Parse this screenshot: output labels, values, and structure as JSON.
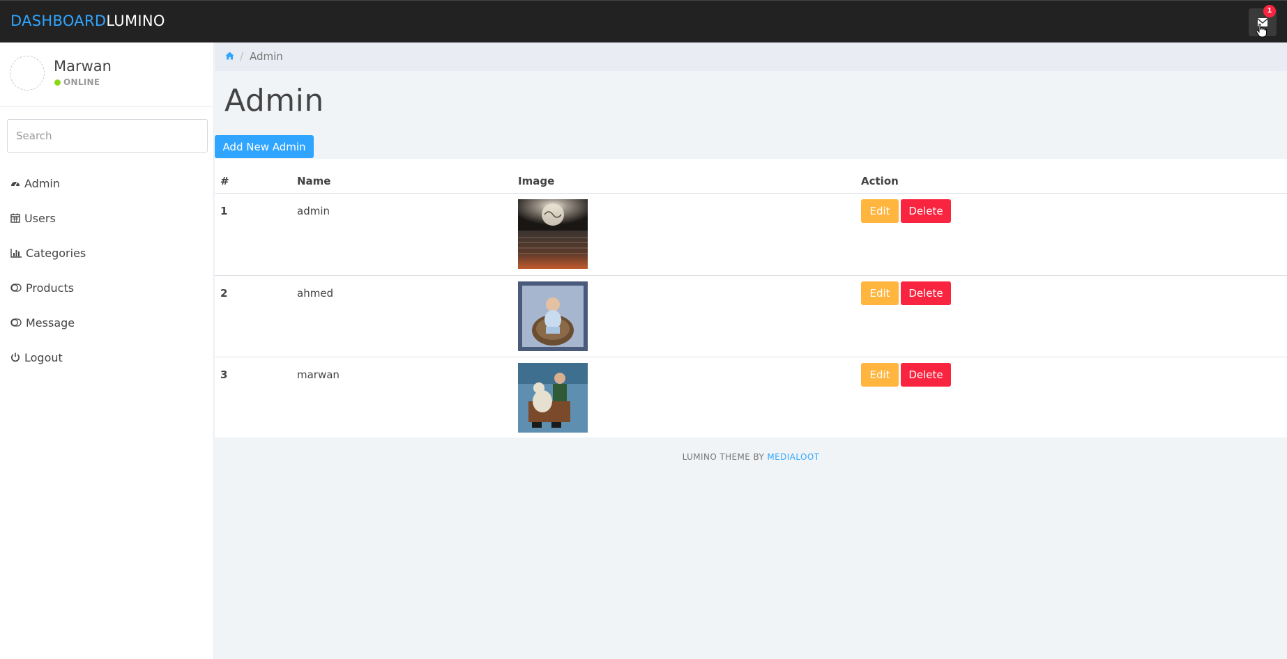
{
  "brand": {
    "part1": "DASHBOARD",
    "part2": "LUMINO"
  },
  "header": {
    "notification_count": "1",
    "icons": [
      "envelope-icon"
    ]
  },
  "profile": {
    "name": "Marwan",
    "status": "ONLINE",
    "status_color": "#8ad919"
  },
  "search": {
    "placeholder": "Search"
  },
  "sidebar": {
    "items": [
      {
        "label": "Admin",
        "icon": "dashboard-icon"
      },
      {
        "label": "Users",
        "icon": "calendar-icon"
      },
      {
        "label": "Categories",
        "icon": "bar-chart-icon"
      },
      {
        "label": "Products",
        "icon": "toggle-icon"
      },
      {
        "label": "Message",
        "icon": "toggle-icon"
      },
      {
        "label": "Logout",
        "icon": "power-icon"
      }
    ]
  },
  "breadcrumb": {
    "current": "Admin"
  },
  "page": {
    "title": "Admin",
    "add_button": "Add New Admin"
  },
  "table": {
    "headers": [
      "#",
      "Name",
      "Image",
      "Action"
    ],
    "rows": [
      {
        "num": "1",
        "name": "admin",
        "image": "moon-over-sea-photo"
      },
      {
        "num": "2",
        "name": "ahmed",
        "image": "child-in-chair-photo"
      },
      {
        "num": "3",
        "name": "marwan",
        "image": "child-with-teddy-photo"
      }
    ],
    "edit_label": "Edit",
    "delete_label": "Delete"
  },
  "footer": {
    "text": "LUMINO THEME BY",
    "link": "MEDIALOOT"
  },
  "colors": {
    "accent": "#30a5ff",
    "warning": "#ffb53e",
    "danger": "#f9243f",
    "topbar": "#222222"
  }
}
